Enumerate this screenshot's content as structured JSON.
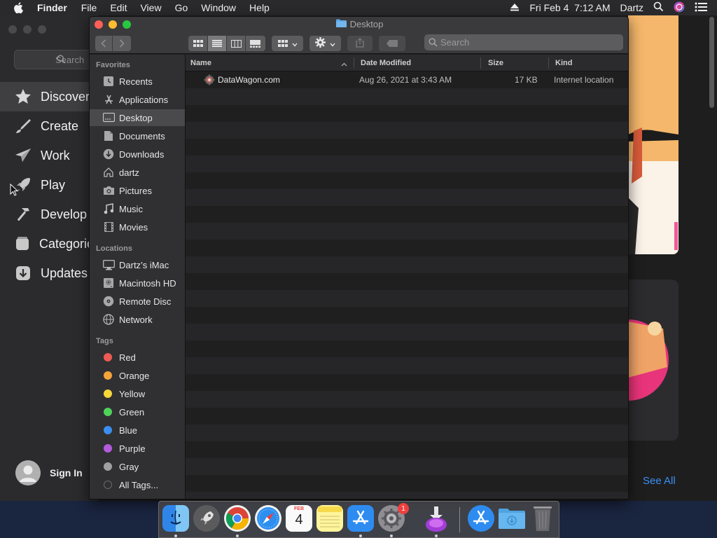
{
  "menubar": {
    "app_name": "Finder",
    "items": [
      "File",
      "Edit",
      "View",
      "Go",
      "Window",
      "Help"
    ],
    "datetime": "Fri Feb 4  7:12 AM",
    "user": "Dartz"
  },
  "appstore": {
    "search_placeholder": "Search",
    "nav": [
      {
        "label": "Discover",
        "icon": "star-icon"
      },
      {
        "label": "Create",
        "icon": "brush-icon"
      },
      {
        "label": "Work",
        "icon": "paper-plane-icon"
      },
      {
        "label": "Play",
        "icon": "rocket-icon"
      },
      {
        "label": "Develop",
        "icon": "hammer-icon"
      },
      {
        "label": "Categories",
        "icon": "stack-icon"
      },
      {
        "label": "Updates",
        "icon": "download-icon"
      }
    ],
    "sign_in": "Sign In",
    "see_all": "See All"
  },
  "finder": {
    "title": "Desktop",
    "search_placeholder": "Search",
    "sidebar": {
      "favorites_header": "Favorites",
      "favorites": [
        "Recents",
        "Applications",
        "Desktop",
        "Documents",
        "Downloads",
        "dartz",
        "Pictures",
        "Music",
        "Movies"
      ],
      "locations_header": "Locations",
      "locations": [
        "Dartz’s iMac",
        "Macintosh HD",
        "Remote Disc",
        "Network"
      ],
      "tags_header": "Tags",
      "tags": [
        {
          "label": "Red",
          "color": "#ec5b54"
        },
        {
          "label": "Orange",
          "color": "#f5a33b"
        },
        {
          "label": "Yellow",
          "color": "#f5d63b"
        },
        {
          "label": "Green",
          "color": "#4ed25a"
        },
        {
          "label": "Blue",
          "color": "#3a8ef0"
        },
        {
          "label": "Purple",
          "color": "#b35bdd"
        },
        {
          "label": "Gray",
          "color": "#a0a0a2"
        }
      ],
      "all_tags": "All Tags..."
    },
    "columns": {
      "name": "Name",
      "date": "Date Modified",
      "size": "Size",
      "kind": "Kind"
    },
    "files": [
      {
        "name": "DataWagon.com",
        "date": "Aug 26, 2021 at 3:43 AM",
        "size": "17 KB",
        "kind": "Internet location"
      }
    ]
  },
  "dock": {
    "calendar_month": "FEB",
    "calendar_day": "4",
    "settings_badge": "1"
  }
}
